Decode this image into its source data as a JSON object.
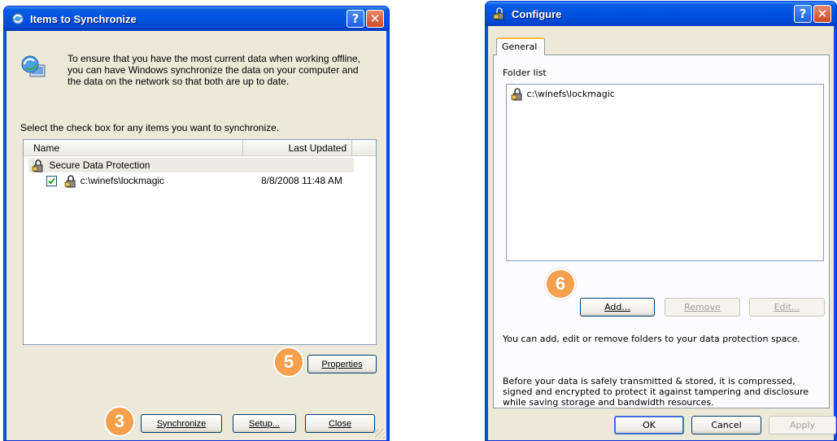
{
  "left_window": {
    "title": "Items to Synchronize",
    "intro": "To ensure that you have the most current data when working offline, you can have Windows synchronize the data on your computer and the data on the network so that both are up to date.",
    "instruction": "Select the check box for any items you want to synchronize.",
    "columns": {
      "name": "Name",
      "last_updated": "Last Updated"
    },
    "group": "Secure Data Protection",
    "item": {
      "name": "c:\\winefs\\lockmagic",
      "last_updated": "8/8/2008 11:48 AM",
      "checked": true
    },
    "buttons": {
      "properties": "Properties",
      "synchronize": "Synchronize",
      "setup": "Setup...",
      "close": "Close"
    }
  },
  "right_window": {
    "title": "Configure",
    "tab": "General",
    "folder_list_label": "Folder list",
    "folders": [
      "c:\\winefs\\lockmagic"
    ],
    "buttons": {
      "add": "Add...",
      "remove": "Remove",
      "edit": "Edit...",
      "ok": "OK",
      "cancel": "Cancel",
      "apply": "Apply"
    },
    "info1": "You can add, edit or remove folders to your data protection space.",
    "info2": "Before your data is safely transmitted & stored, it is compressed, signed and encrypted to protect it against tampering and disclosure while saving storage and bandwidth resources."
  },
  "callouts": {
    "synchronize": "3",
    "properties": "5",
    "add": "6"
  },
  "colors": {
    "title_bar": "#0054e3",
    "dialog_bg": "#ece9d8",
    "callout": "#f6a04d",
    "close_button": "#d04a21"
  },
  "icons": {
    "sync": "sync-globe-icon",
    "lock": "folder-lock-icon",
    "help": "help-icon",
    "close": "close-icon"
  }
}
